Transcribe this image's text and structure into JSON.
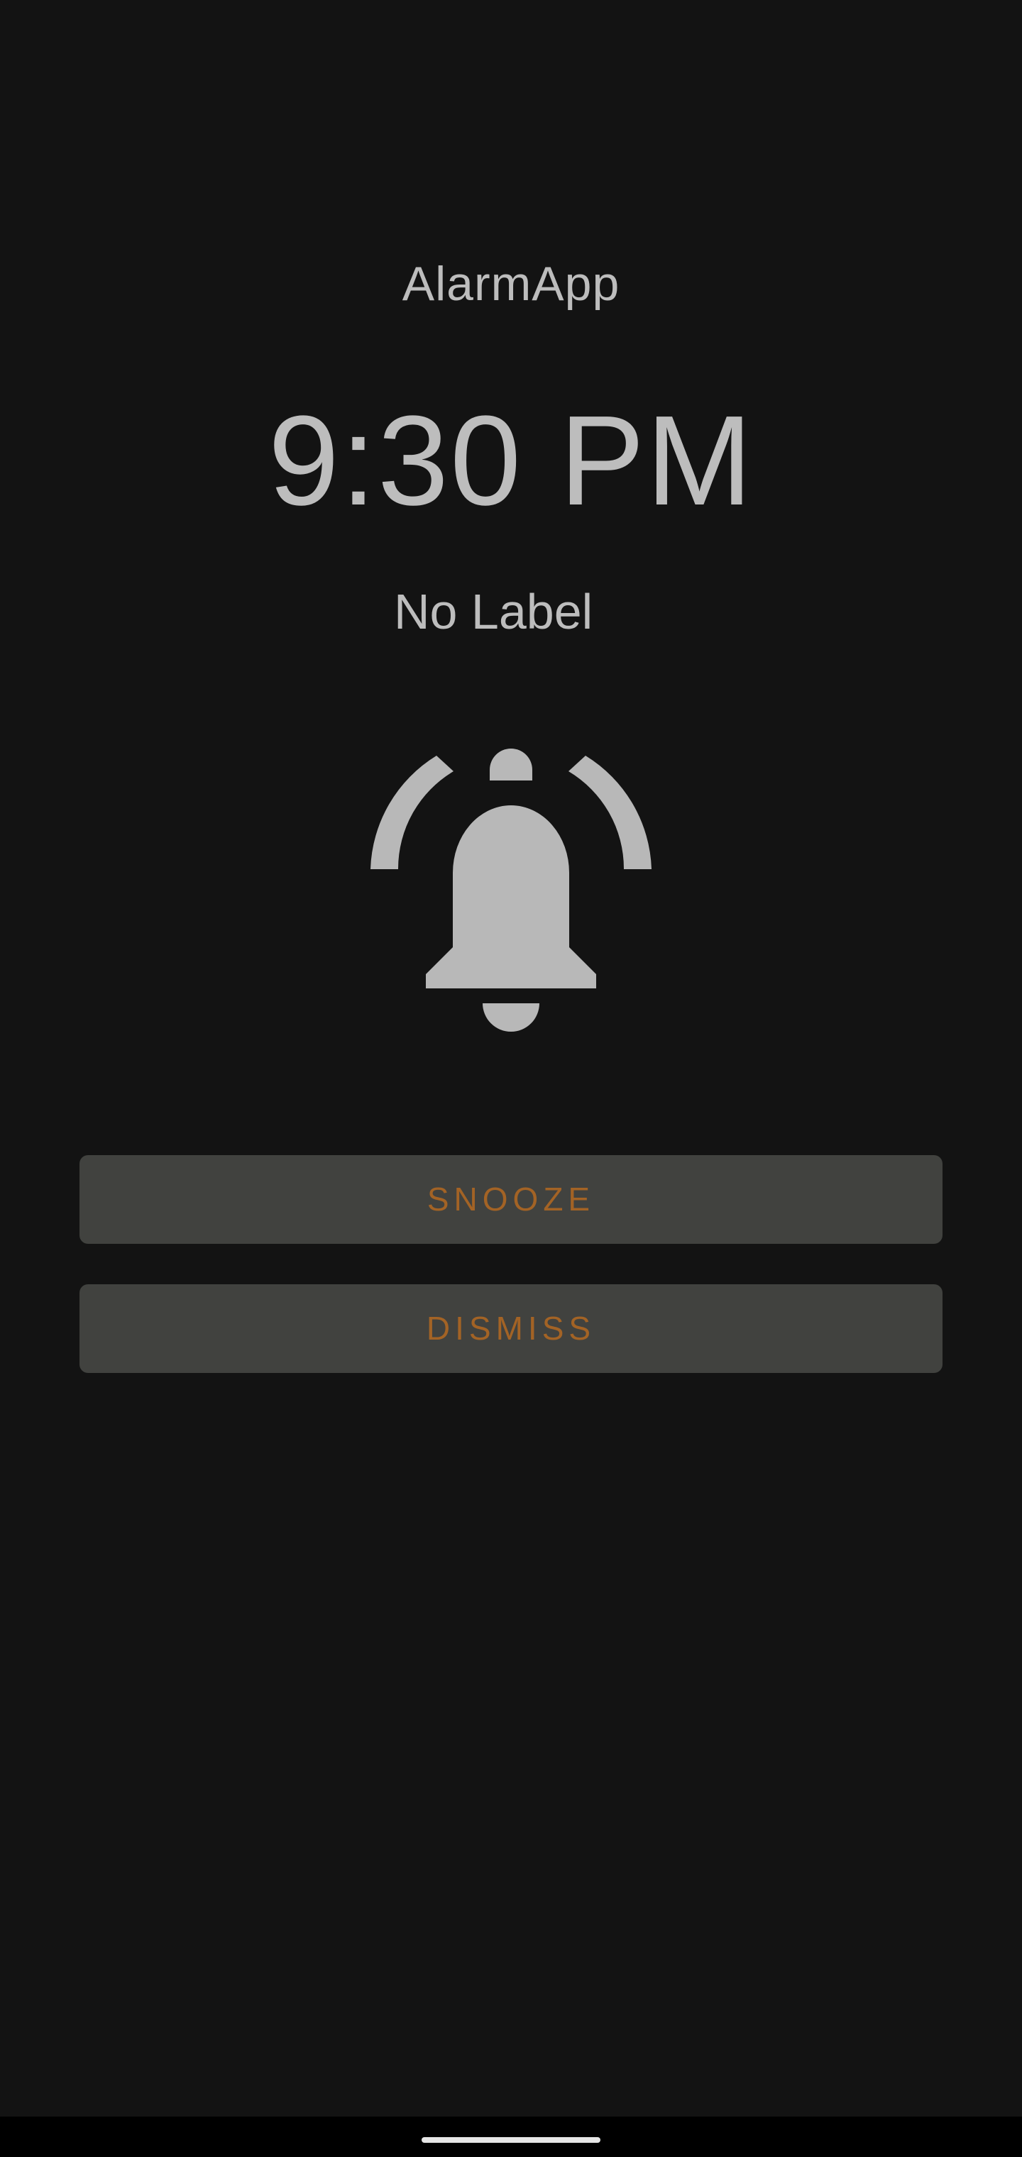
{
  "app": {
    "title": "AlarmApp"
  },
  "alarm": {
    "time": "9:30 PM",
    "label": "No Label",
    "icon": "alarm-bell-icon"
  },
  "actions": {
    "snooze_label": "SNOOZE",
    "dismiss_label": "DISMISS"
  },
  "theme": {
    "background": "#131313",
    "text": "#bdbdbd",
    "button_background": "#41423f",
    "button_text": "#a36325",
    "nav_bar": "#000000"
  }
}
